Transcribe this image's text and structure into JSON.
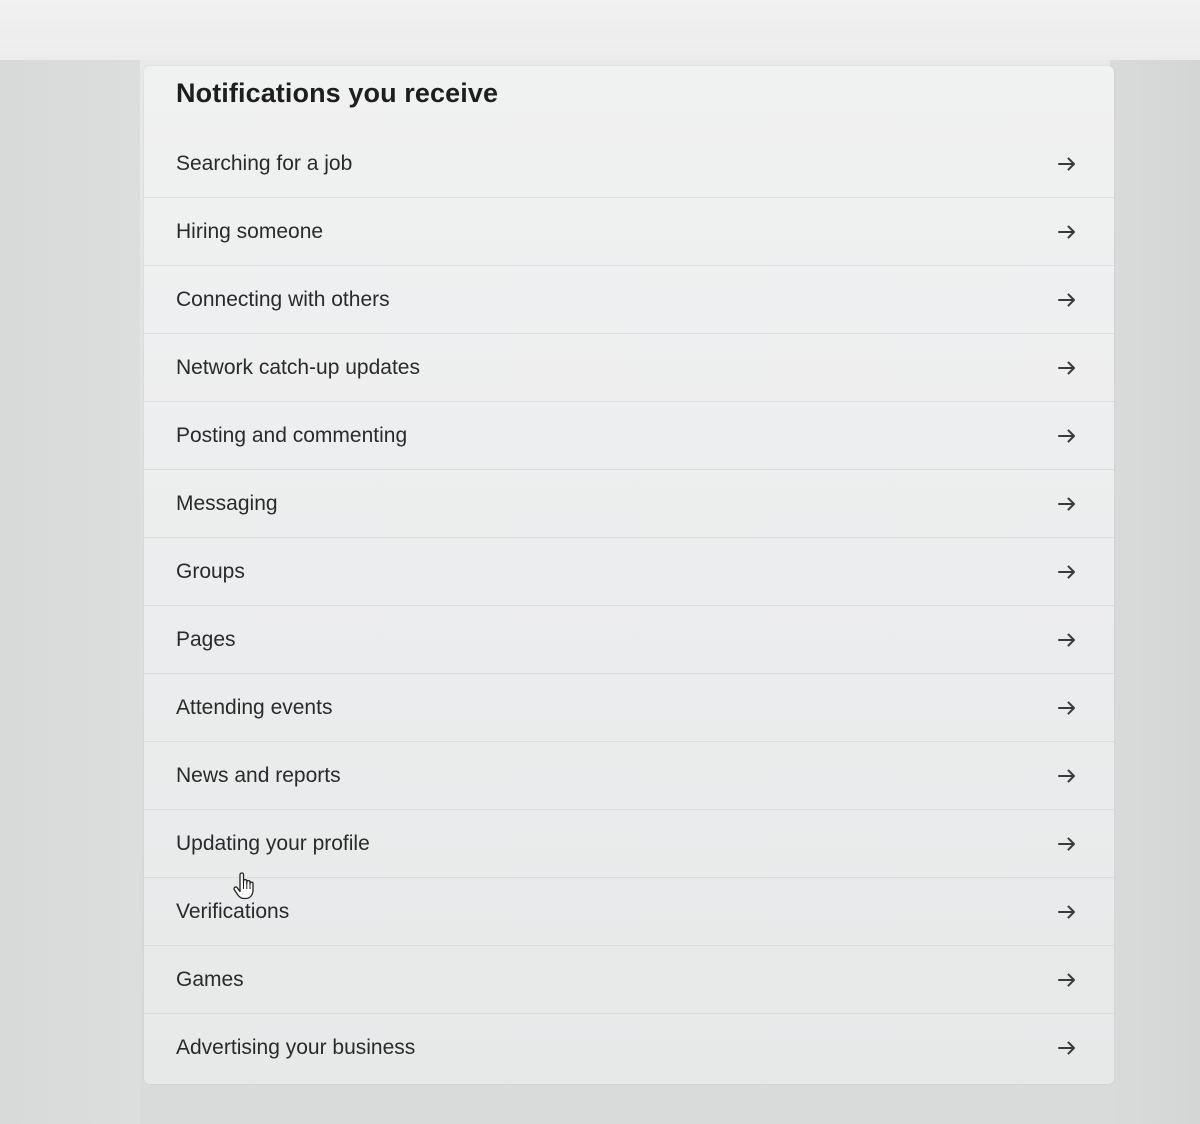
{
  "section": {
    "title": "Notifications you receive"
  },
  "items": [
    {
      "label": "Searching for a job",
      "icon": "arrow-right-icon"
    },
    {
      "label": "Hiring someone",
      "icon": "arrow-right-icon"
    },
    {
      "label": "Connecting with others",
      "icon": "arrow-right-icon"
    },
    {
      "label": "Network catch-up updates",
      "icon": "arrow-right-icon"
    },
    {
      "label": "Posting and commenting",
      "icon": "arrow-right-icon"
    },
    {
      "label": "Messaging",
      "icon": "arrow-right-icon"
    },
    {
      "label": "Groups",
      "icon": "arrow-right-icon"
    },
    {
      "label": "Pages",
      "icon": "arrow-right-icon"
    },
    {
      "label": "Attending events",
      "icon": "arrow-right-icon"
    },
    {
      "label": "News and reports",
      "icon": "arrow-right-icon"
    },
    {
      "label": "Updating your profile",
      "icon": "arrow-right-icon"
    },
    {
      "label": "Verifications",
      "icon": "arrow-right-icon"
    },
    {
      "label": "Games",
      "icon": "arrow-right-icon"
    },
    {
      "label": "Advertising your business",
      "icon": "arrow-right-icon"
    }
  ],
  "colors": {
    "text": "#2a2a2a",
    "title": "#1e1e1e",
    "divider": "#dcdede",
    "card_background": "#eeefef"
  },
  "cursor": {
    "icon": "hand-pointer-icon"
  }
}
